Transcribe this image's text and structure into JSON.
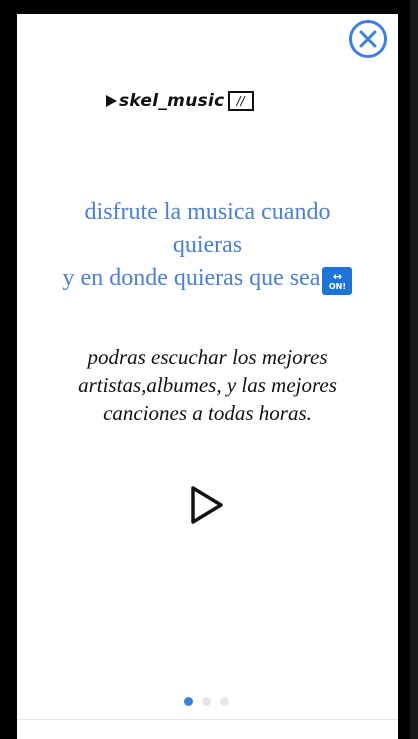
{
  "close": {
    "icon": "close-icon",
    "color": "#3b7fe0"
  },
  "logo": {
    "text": "skel_music",
    "box_text": "//"
  },
  "headline": {
    "line1": "disfrute la musica cuando",
    "line2": "quieras",
    "line3": "y en donde quieras que sea",
    "badge_text": "ON!",
    "color": "#4a7fd4"
  },
  "subtitle": {
    "line1": "podras escuchar los mejores",
    "line2": "artistas,albumes, y las mejores",
    "line3": "canciones a todas horas."
  },
  "play": {
    "icon": "play-icon"
  },
  "pagination": {
    "count": 3,
    "active_index": 0,
    "active_color": "#3b7fe0"
  }
}
